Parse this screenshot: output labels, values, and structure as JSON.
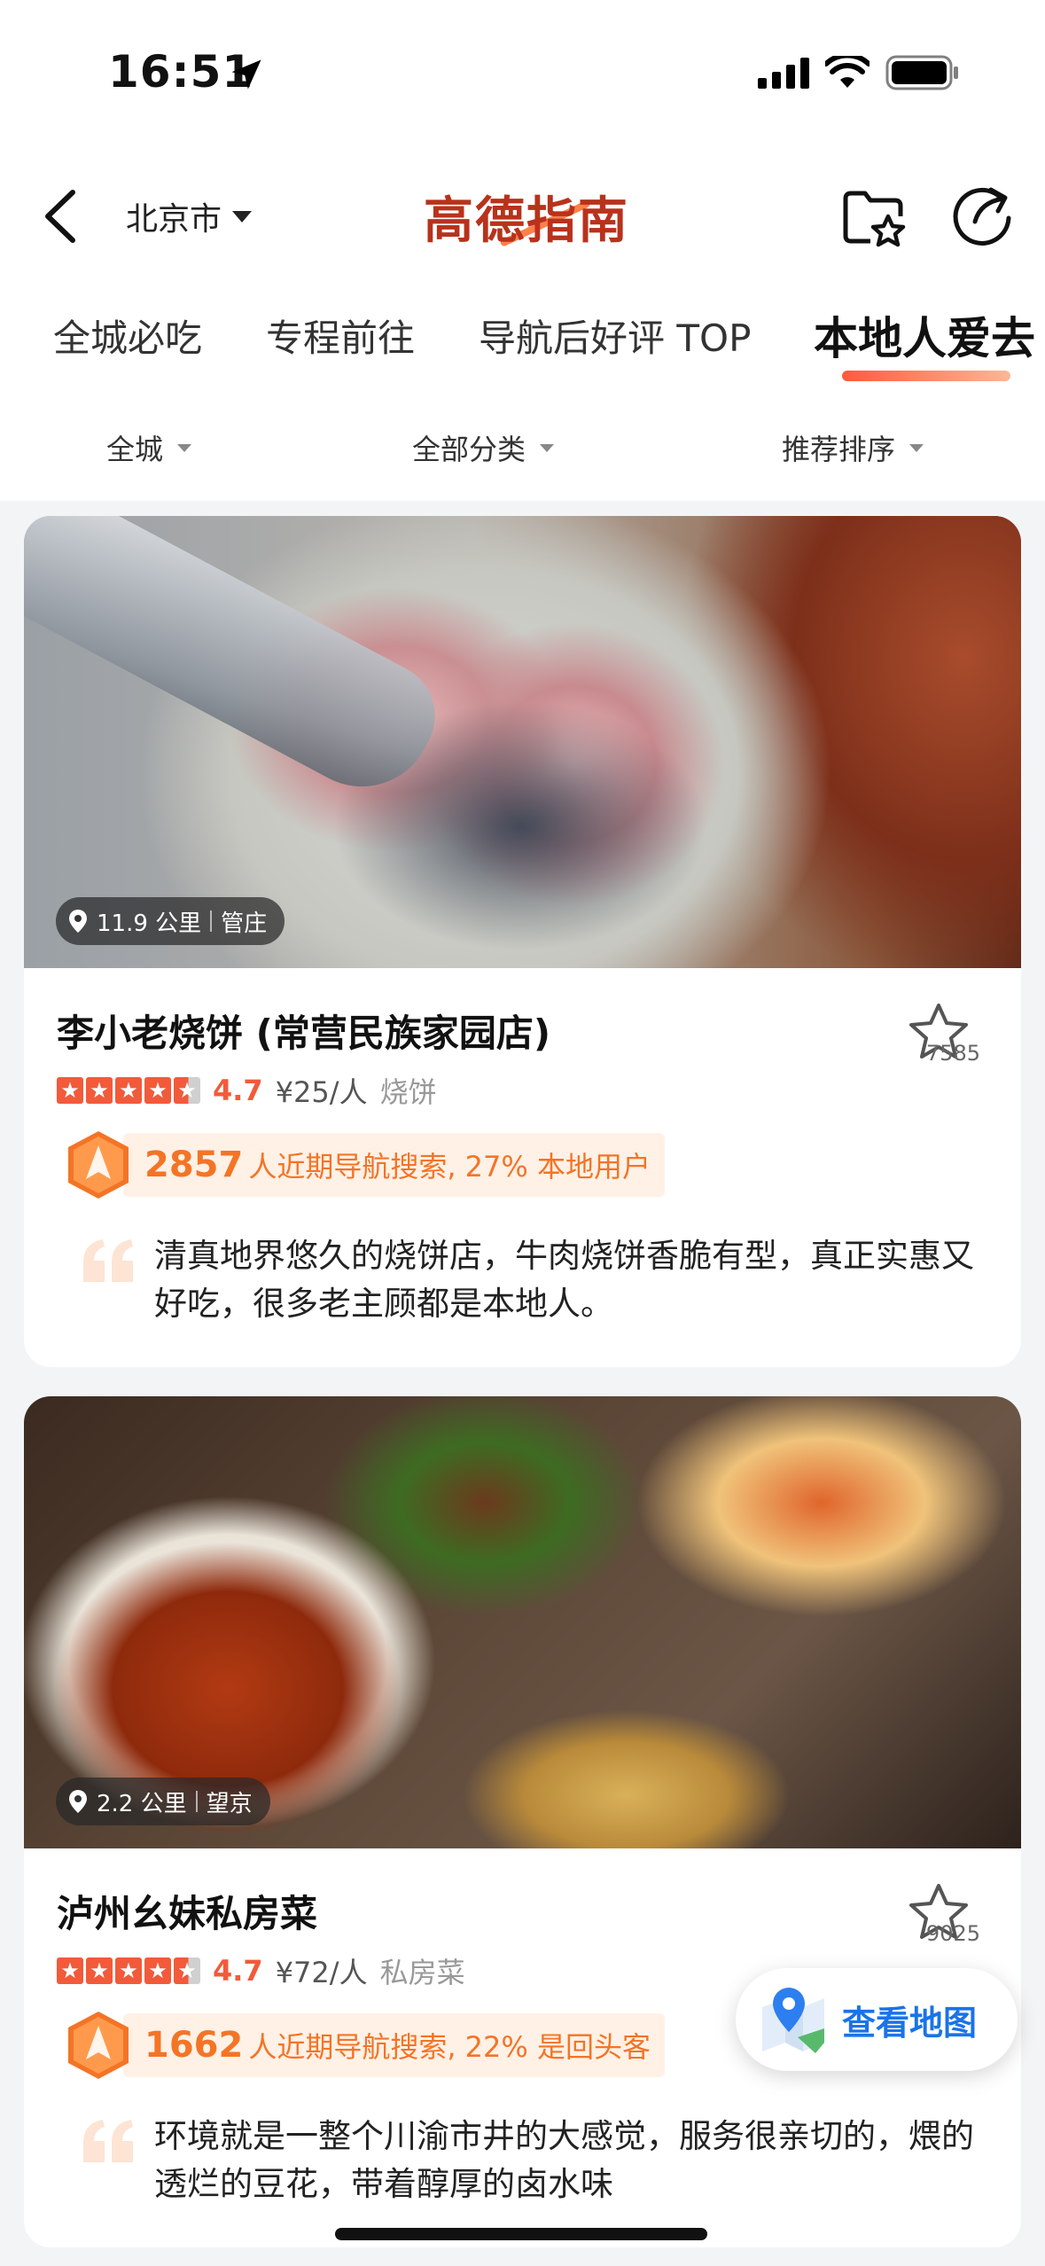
{
  "status_bar": {
    "time": "16:51",
    "icons": [
      "location-arrow-icon",
      "cellular-signal-icon",
      "wifi-icon",
      "battery-icon"
    ]
  },
  "header": {
    "city": "北京市",
    "brand_title": "高德指南",
    "icons": [
      "back-icon",
      "caret-down-icon",
      "favorite-folder-icon",
      "share-icon"
    ],
    "brand_color": "#b8321c"
  },
  "tabs": [
    {
      "label": "全城必吃"
    },
    {
      "label": "专程前往"
    },
    {
      "label": "导航后好评 TOP"
    },
    {
      "label": "本地人爱去",
      "active": true
    }
  ],
  "filters": [
    {
      "label": "全城"
    },
    {
      "label": "全部分类"
    },
    {
      "label": "推荐排序"
    }
  ],
  "cards": [
    {
      "distance": "11.9 公里",
      "area": "管庄",
      "name": "李小老烧饼 (常营民族家园店)",
      "favorites": "7585",
      "rating_value": 4.7,
      "rating": "4.7",
      "price": "¥25/人",
      "category": "烧饼",
      "nav_count": "2857",
      "nav_text": "人近期导航搜索, 27% 本地用户",
      "review": "清真地界悠久的烧饼店，牛肉烧饼香脆有型，真正实惠又好吃，很多老主顾都是本地人。"
    },
    {
      "distance": "2.2 公里",
      "area": "望京",
      "name": "泸州幺妹私房菜",
      "favorites": "9025",
      "rating_value": 4.7,
      "rating": "4.7",
      "price": "¥72/人",
      "category": "私房菜",
      "nav_count": "1662",
      "nav_text": "人近期导航搜索, 22% 是回头客",
      "review": "环境就是一整个川渝市井的大感觉，服务很亲切的，煨的透烂的豆花，带着醇厚的卤水味"
    }
  ],
  "map_button": {
    "label": "查看地图",
    "icon": "map-pin-icon"
  },
  "colors": {
    "accent_red": "#f25a3a",
    "accent_orange": "#f47426",
    "stat_bg": "#fff1e6",
    "map_blue": "#1a73e8"
  }
}
